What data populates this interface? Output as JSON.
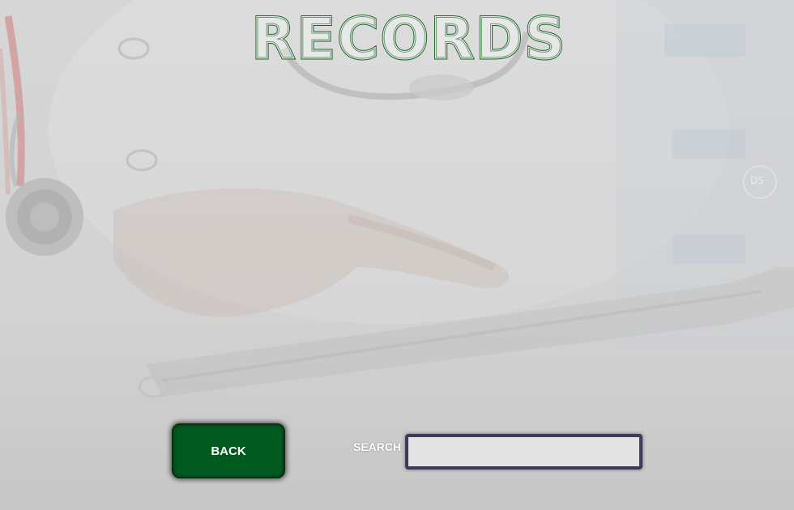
{
  "header": {
    "title": "RECORDS",
    "title_color": "#1f5c27"
  },
  "background": {
    "description_icon": "doctor-with-stethoscope-using-tablet-photo",
    "watermark": "DS"
  },
  "actions": {
    "back_label": "BACK",
    "back_color": "#005a20"
  },
  "search": {
    "label": "SEARCH",
    "value": "",
    "placeholder": "",
    "border_color": "#3d3a5a"
  }
}
